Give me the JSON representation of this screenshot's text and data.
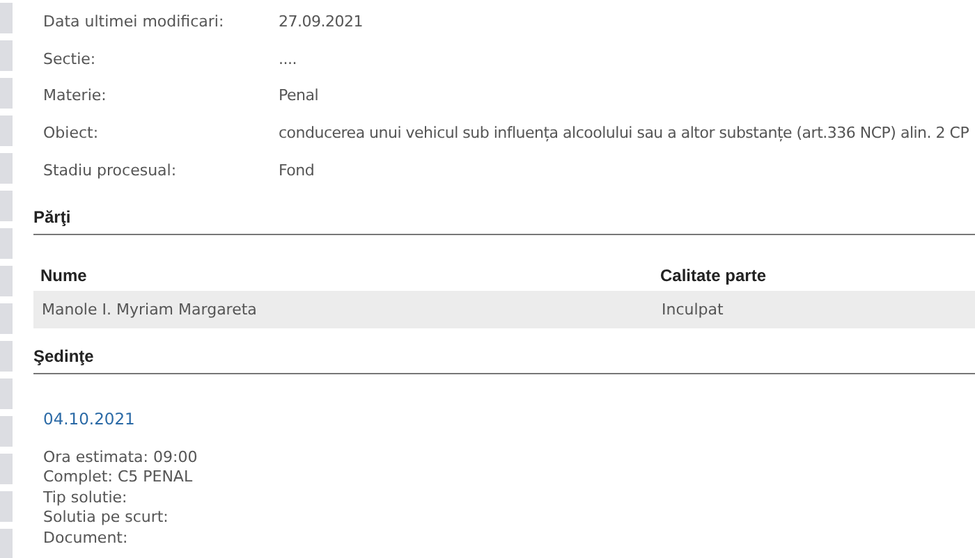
{
  "details": [
    {
      "label": "Data ultimei modificari:",
      "value": "27.09.2021"
    },
    {
      "label": "Sectie:",
      "value": "...."
    },
    {
      "label": "Materie:",
      "value": "Penal"
    },
    {
      "label": "Obiect:",
      "value": "conducerea unui vehicul sub influența alcoolului sau a altor substanțe (art.336 NCP) alin. 2 CP"
    },
    {
      "label": "Stadiu procesual:",
      "value": "Fond"
    }
  ],
  "parti": {
    "title": "Părţi",
    "columns": [
      "Nume",
      "Calitate parte"
    ],
    "rows": [
      [
        "Manole I. Myriam Margareta",
        "Inculpat"
      ]
    ]
  },
  "sedinte": {
    "title": "Şedinţe",
    "date": "04.10.2021",
    "lines": [
      "Ora estimata: 09:00",
      "Complet: C5 PENAL",
      "Tip solutie:",
      "Solutia pe scurt:",
      "Document:"
    ]
  }
}
